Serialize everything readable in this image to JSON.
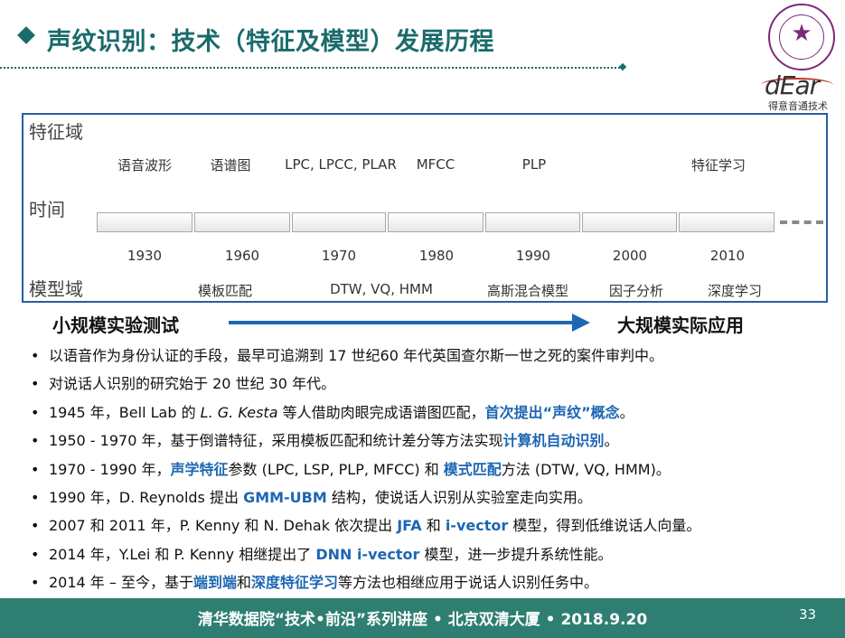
{
  "header": {
    "title": "声纹识别：技术（特征及模型）发展历程",
    "logo_text": "dEar",
    "logo_subtitle": "得意音通技术"
  },
  "timeline": {
    "feature_domain_label": "特征域",
    "time_label": "时间",
    "model_domain_label": "模型域",
    "features": [
      "语音波形",
      "语谱图",
      "LPC, LPCC, PLAR",
      "MFCC",
      "PLP",
      "特征学习"
    ],
    "years": [
      "1930",
      "1960",
      "1970",
      "1980",
      "1990",
      "2000",
      "2010"
    ],
    "models": [
      "模板匹配",
      "DTW, VQ, HMM",
      "高斯混合模型",
      "因子分析",
      "深度学习"
    ]
  },
  "scale": {
    "left": "小规模实验测试",
    "right": "大规模实际应用"
  },
  "bullet_char": "•",
  "bullets": [
    [
      {
        "t": "以语音作为身份认证的手段，最早可追溯到 17 世纪60 年代英国查尔斯一世之死的案件审判中。"
      }
    ],
    [
      {
        "t": "对说话人识别的研究始于 20 世纪 30 年代。"
      }
    ],
    [
      {
        "t": "1945 年，Bell Lab 的 "
      },
      {
        "t": "L. G. Kesta",
        "s": "it"
      },
      {
        "t": " 等人借助肉眼完成语谱图匹配，"
      },
      {
        "t": "首次提出“声纹”概念",
        "s": "hl"
      },
      {
        "t": "。"
      }
    ],
    [
      {
        "t": "1950 - 1970 年，基于倒谱特征，采用模板匹配和统计差分等方法实现"
      },
      {
        "t": "计算机自动识别",
        "s": "hl"
      },
      {
        "t": "。"
      }
    ],
    [
      {
        "t": "1970 - 1990 年，"
      },
      {
        "t": "声学特征",
        "s": "hl"
      },
      {
        "t": "参数 (LPC, LSP, PLP, MFCC) 和 "
      },
      {
        "t": "模式匹配",
        "s": "hl"
      },
      {
        "t": "方法 (DTW, VQ, HMM)。"
      }
    ],
    [
      {
        "t": "1990 年，D. Reynolds 提出 "
      },
      {
        "t": "GMM-UBM",
        "s": "hl"
      },
      {
        "t": " 结构，使说话人识别从实验室走向实用。"
      }
    ],
    [
      {
        "t": "2007 和 2011 年，P. Kenny 和 N. Dehak 依次提出 "
      },
      {
        "t": "JFA",
        "s": "hl"
      },
      {
        "t": " 和 "
      },
      {
        "t": "i-vector",
        "s": "hl"
      },
      {
        "t": " 模型，得到低维说话人向量。"
      }
    ],
    [
      {
        "t": "2014 年，Y.Lei 和 P. Kenny 相继提出了 "
      },
      {
        "t": "DNN i-vector",
        "s": "hl"
      },
      {
        "t": " 模型，进一步提升系统性能。"
      }
    ],
    [
      {
        "t": "2014 年 – 至今，基于"
      },
      {
        "t": "端到端",
        "s": "hl"
      },
      {
        "t": "和"
      },
      {
        "t": "深度特征学习",
        "s": "hl"
      },
      {
        "t": "等方法也相继应用于说话人识别任务中。"
      }
    ]
  ],
  "footer": {
    "text": "清华数据院“技术•前沿”系列讲座 • 北京双清大厦 • 2018.9.20",
    "page": "33"
  },
  "colors": {
    "title": "#1a6b6b",
    "highlight": "#1d67b3",
    "footer_bg": "#2e7f72",
    "panel_border": "#2a5d9f"
  }
}
